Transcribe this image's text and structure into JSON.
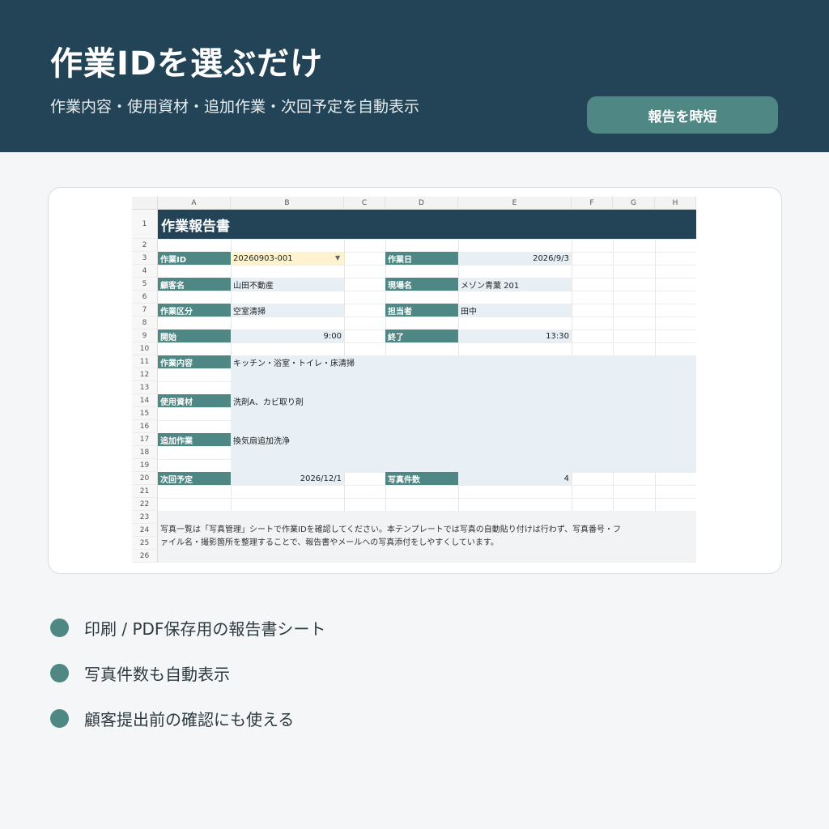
{
  "header": {
    "title": "作業IDを選ぶだけ",
    "subtitle": "作業内容・使用資材・追加作業・次回予定を自動表示",
    "button_label": "報告を時短"
  },
  "colors": {
    "header_bg": "#234457",
    "accent": "#4f8784",
    "value_bg": "#e8f0f6",
    "highlight": "#fdf4cf"
  },
  "sheet": {
    "columns": [
      "A",
      "B",
      "C",
      "D",
      "E",
      "F",
      "G",
      "H"
    ],
    "rows": [
      "1",
      "2",
      "3",
      "4",
      "5",
      "6",
      "7",
      "8",
      "9",
      "10",
      "11",
      "12",
      "13",
      "14",
      "15",
      "16",
      "17",
      "18",
      "19",
      "20",
      "21",
      "22",
      "23",
      "24",
      "25",
      "26"
    ],
    "title": "作業報告書",
    "fields": {
      "work_id_label": "作業ID",
      "work_id_value": "20260903-001",
      "work_date_label": "作業日",
      "work_date_value": "2026/9/3",
      "customer_label": "顧客名",
      "customer_value": "山田不動産",
      "site_label": "現場名",
      "site_value": "メゾン青葉 201",
      "category_label": "作業区分",
      "category_value": "空室清掃",
      "staff_label": "担当者",
      "staff_value": "田中",
      "start_label": "開始",
      "start_value": "9:00",
      "end_label": "終了",
      "end_value": "13:30",
      "content_label": "作業内容",
      "content_value": "キッチン・浴室・トイレ・床清掃",
      "materials_label": "使用資材",
      "materials_value": "洗剤A、カビ取り剤",
      "extra_label": "追加作業",
      "extra_value": "換気扇追加洗浄",
      "next_label": "次回予定",
      "next_value": "2026/12/1",
      "photos_label": "写真件数",
      "photos_value": "4"
    },
    "note_line1": "写真一覧は「写真管理」シートで作業IDを確認してください。本テンプレートでは写真の自動貼り付けは行わず、写真番号・フ",
    "note_line2": "ァイル名・撮影箇所を整理することで、報告書やメールへの写真添付をしやすくしています。"
  },
  "bullets": [
    "印刷 / PDF保存用の報告書シート",
    "写真件数も自動表示",
    "顧客提出前の確認にも使える"
  ]
}
